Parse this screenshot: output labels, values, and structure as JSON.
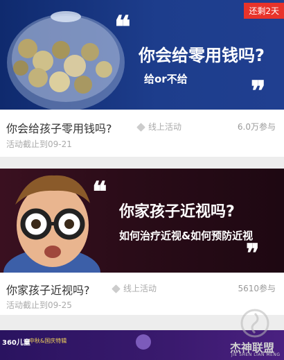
{
  "cards": [
    {
      "banner": {
        "headline": "你会给零用钱吗?",
        "subline": "给or不给",
        "open_quote": "❝",
        "close_quote": "❞",
        "bg_color": "#1d3d8c"
      },
      "badge": "还剩2天",
      "title": "你会给孩子零用钱吗?",
      "tag": "线上活动",
      "count": "6.0万参与",
      "deadline": "活动截止到09-21"
    },
    {
      "banner": {
        "headline": "你家孩子近视吗?",
        "subline": "如何治疗近视&如何预防近视",
        "open_quote": "❝",
        "close_quote": "❞",
        "bg_color": "#2a0c18"
      },
      "title": "你家孩子近视吗?",
      "tag": "线上活动",
      "count": "5610参与",
      "deadline": "活动截止到09-25"
    },
    {
      "banner": {
        "brand": "360儿童",
        "promo": "中秋&国庆特辑",
        "bg_color": "#3a1a6e"
      }
    }
  ],
  "watermark": {
    "name": "杰神联盟",
    "pinyin": "JIE SHEN LIAN MENG"
  },
  "colors": {
    "accent": "#e8332a",
    "page_bg": "#ededed"
  }
}
